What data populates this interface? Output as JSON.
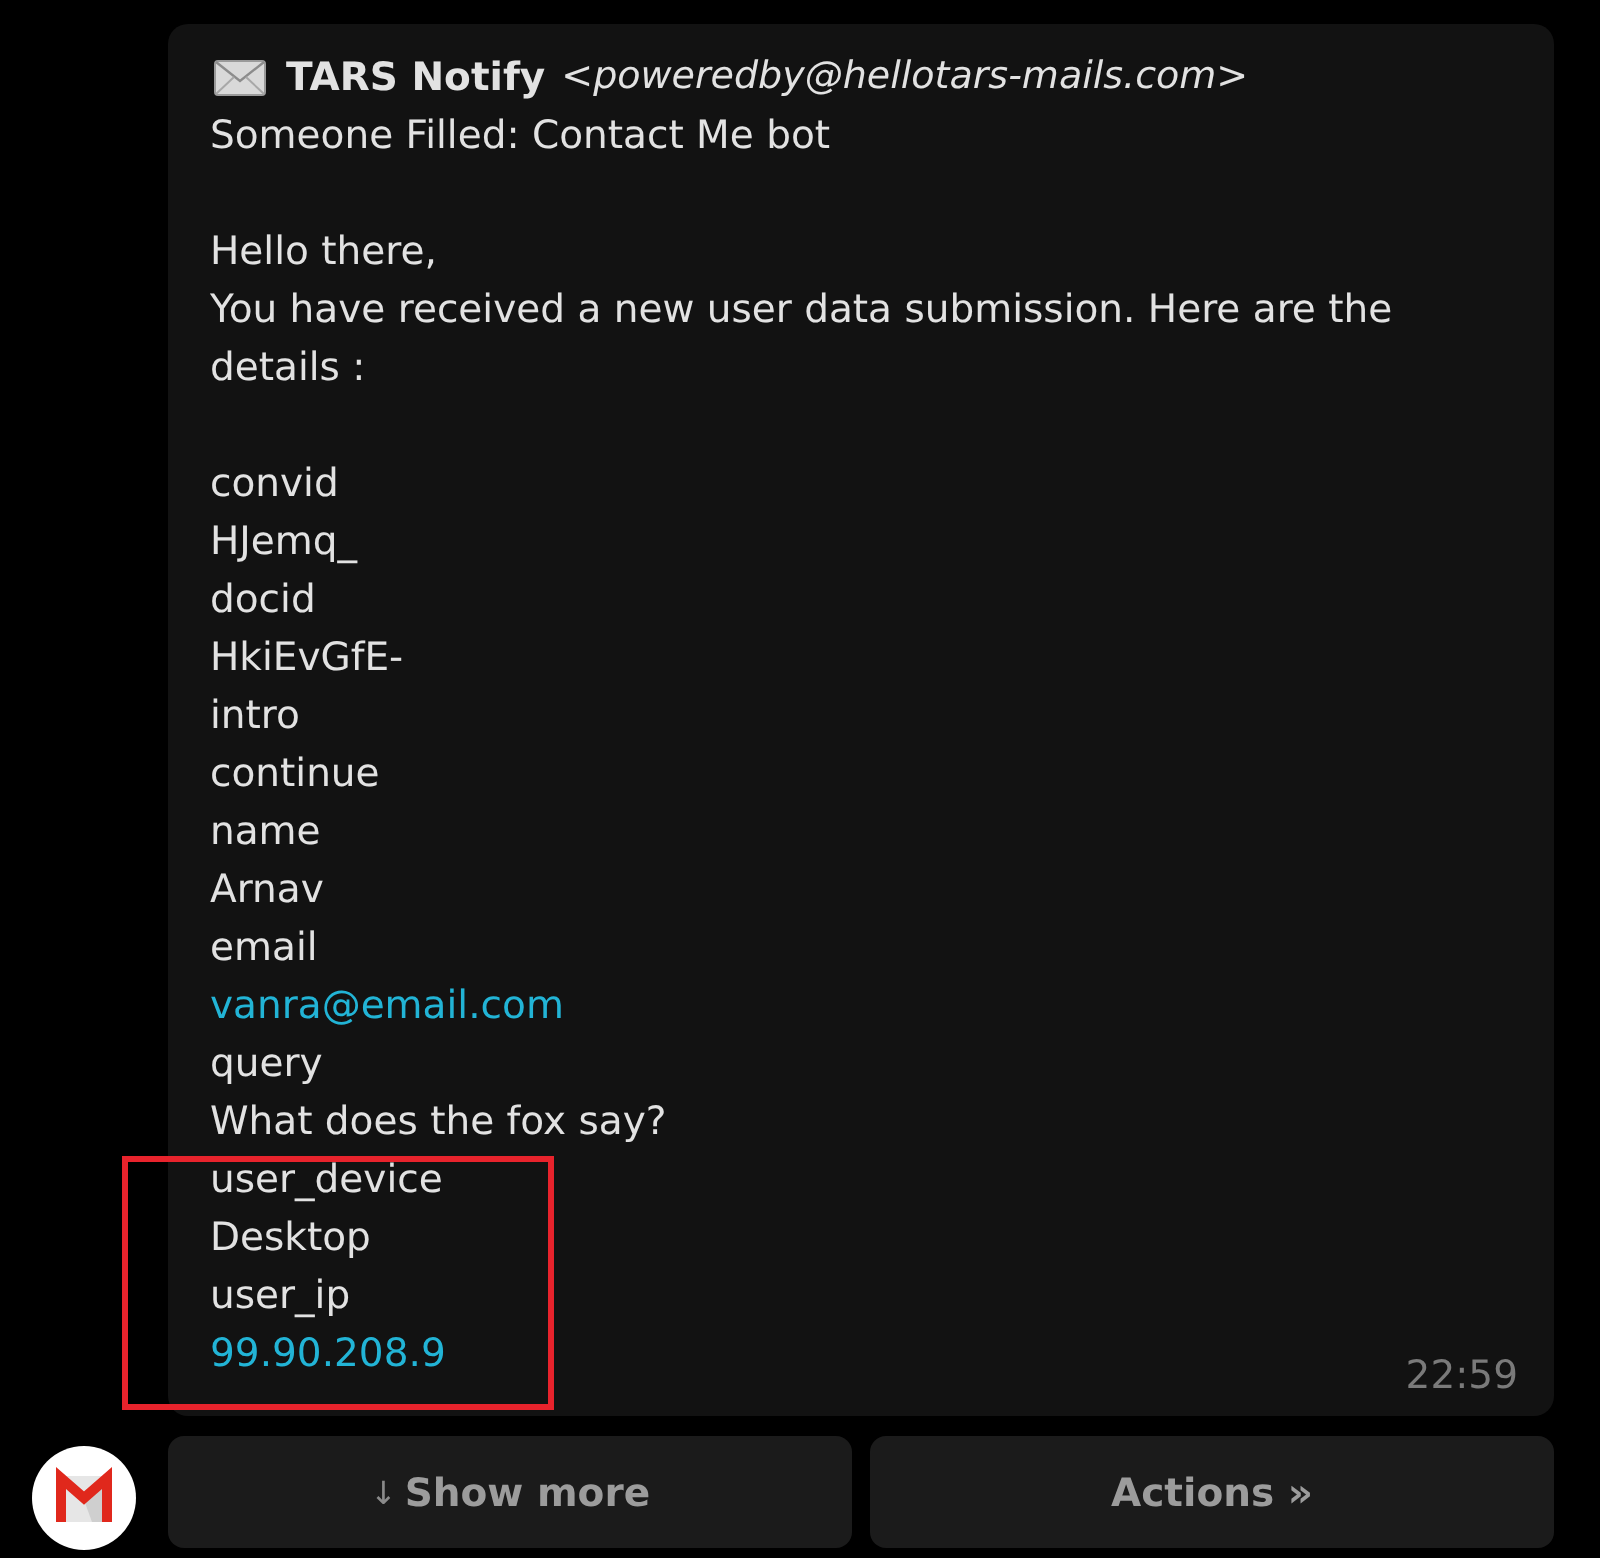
{
  "message": {
    "sender_name": "TARS Notify",
    "sender_address": "<poweredby@hellotars-mails.com>",
    "subject": "Someone Filled: Contact Me bot",
    "greeting": "Hello there,",
    "intro": "You have received a new user data submission. Here are the details :",
    "fields": [
      {
        "label": "convid",
        "value": "HJemq_",
        "kind": "text",
        "highlighted": false
      },
      {
        "label": "docid",
        "value": "HkiEvGfE-",
        "kind": "text",
        "highlighted": false
      },
      {
        "label": "intro",
        "value": "continue",
        "kind": "text",
        "highlighted": false
      },
      {
        "label": "name",
        "value": "Arnav",
        "kind": "text",
        "highlighted": false
      },
      {
        "label": "email",
        "value": "vanra@email.com",
        "kind": "link",
        "highlighted": false
      },
      {
        "label": "query",
        "value": "What does the fox say?",
        "kind": "text",
        "highlighted": false
      },
      {
        "label": "user_device",
        "value": "Desktop",
        "kind": "text",
        "highlighted": true
      },
      {
        "label": "user_ip",
        "value": "99.90.208.9",
        "kind": "link",
        "highlighted": true
      }
    ],
    "time": "22:59"
  },
  "buttons": [
    {
      "icon": "↓",
      "label": "Show more"
    },
    {
      "label": "Actions »"
    }
  ]
}
